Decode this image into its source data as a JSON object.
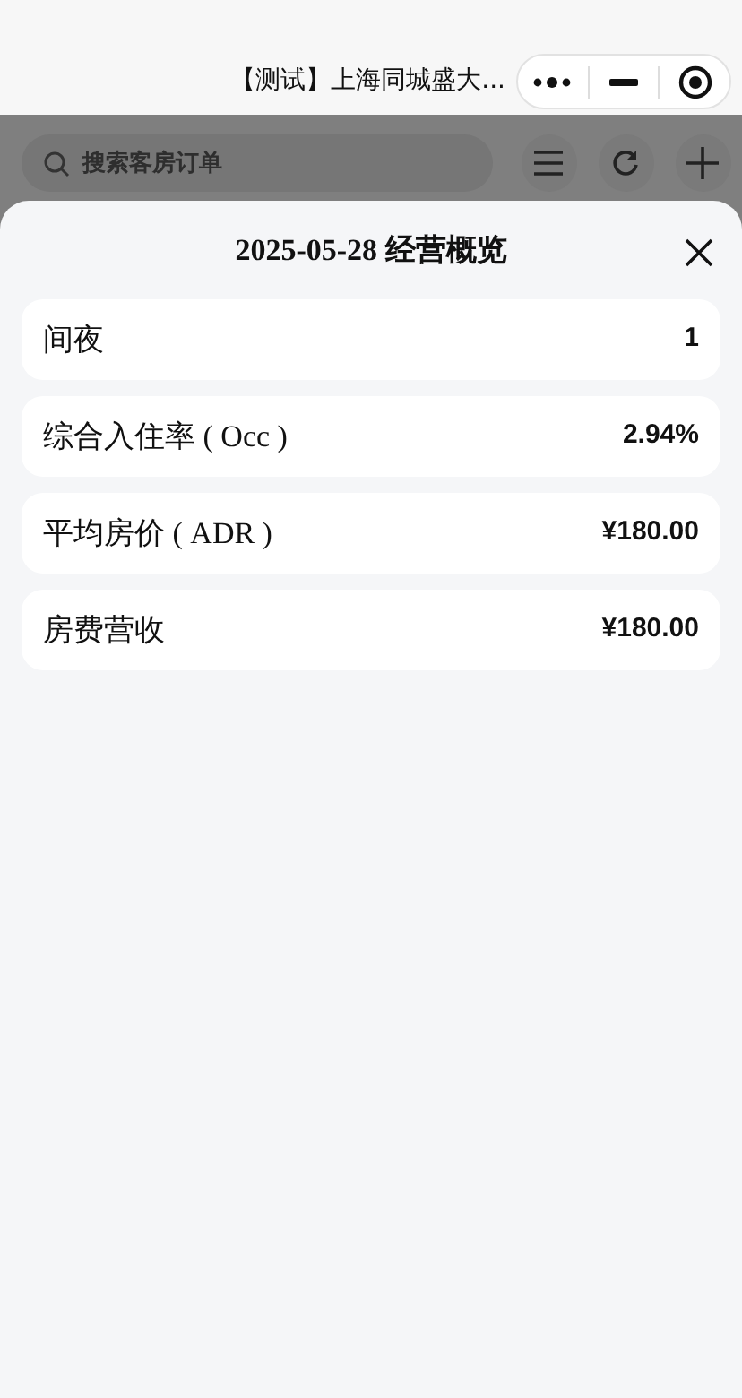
{
  "app_bar": {
    "title": "【测试】上海同城盛大..."
  },
  "search": {
    "placeholder": "搜索客房订单"
  },
  "sheet": {
    "title": "2025-05-28 经营概览",
    "metrics": [
      {
        "label": "间夜",
        "value": "1"
      },
      {
        "label": "综合入住率 ( Occ )",
        "value": "2.94%"
      },
      {
        "label": "平均房价 ( ADR )",
        "value": "¥180.00"
      },
      {
        "label": "房费营收",
        "value": "¥180.00"
      }
    ]
  }
}
